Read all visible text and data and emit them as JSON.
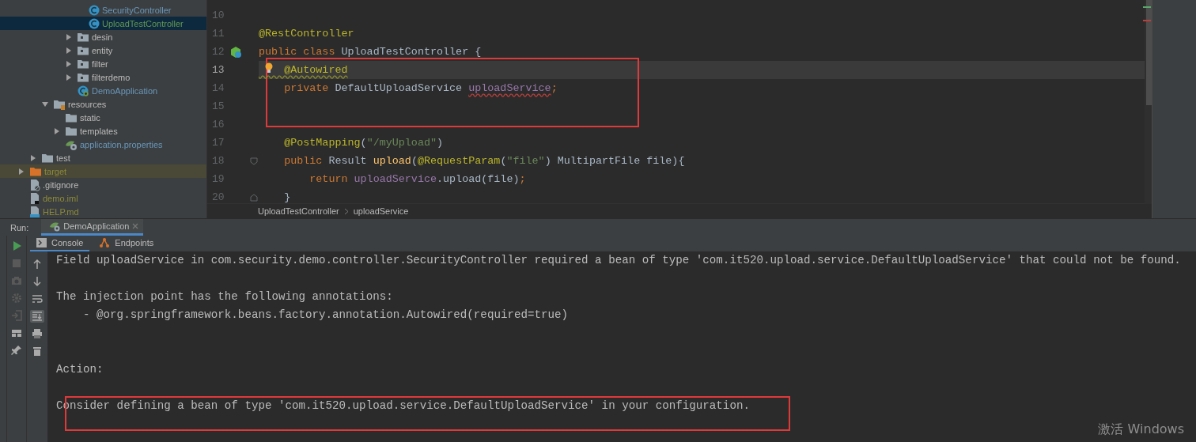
{
  "project_tree": [
    {
      "children": [
        {
          "children": [
            {
              "children": [
                {
                  "children": [
                    {
                      "children": [
                        {
                          "label": "SecurityController",
                          "kind": "class",
                          "color": "#6897bb",
                          "selected": false
                        },
                        {
                          "label": "UploadTestController",
                          "kind": "class",
                          "color": "#629755",
                          "selected": true
                        }
                      ]
                    },
                    {
                      "label": "desin",
                      "kind": "package",
                      "color": "#bbbbbb",
                      "expanded": false,
                      "selected": false
                    },
                    {
                      "label": "entity",
                      "kind": "package",
                      "color": "#bbbbbb",
                      "expanded": false,
                      "selected": false
                    },
                    {
                      "label": "filter",
                      "kind": "package",
                      "color": "#bbbbbb",
                      "expanded": false,
                      "selected": false
                    },
                    {
                      "label": "filterdemo",
                      "kind": "package",
                      "color": "#bbbbbb",
                      "expanded": false,
                      "selected": false
                    },
                    {
                      "label": "DemoApplication",
                      "kind": "spring-class",
                      "color": "#6897bb",
                      "selected": false
                    }
                  ]
                }
              ]
            },
            {
              "label": "resources",
              "kind": "resources-folder",
              "color": "#bbbbbb",
              "expanded": true,
              "selected": false,
              "children": [
                {
                  "label": "static",
                  "kind": "folder",
                  "color": "#bbbbbb",
                  "selected": false
                },
                {
                  "label": "templates",
                  "kind": "folder",
                  "color": "#bbbbbb",
                  "expanded": false,
                  "selected": false
                },
                {
                  "label": "application.properties",
                  "kind": "properties",
                  "color": "#6897bb",
                  "selected": false
                }
              ]
            }
          ]
        },
        {
          "label": "test",
          "kind": "folder",
          "color": "#bbbbbb",
          "expanded": false,
          "selected": false
        }
      ]
    },
    {
      "label": "target",
      "kind": "excluded-folder",
      "color": "#8c8a3a",
      "expanded": false,
      "selected": false
    },
    {
      "label": ".gitignore",
      "kind": "git-file",
      "color": "#bbbbbb",
      "selected": false
    },
    {
      "label": "demo.iml",
      "kind": "module-file",
      "color": "#8c8a3a",
      "selected": false
    },
    {
      "label": "HELP.md",
      "kind": "md-file",
      "color": "#8c8a3a",
      "selected": false
    }
  ],
  "editor": {
    "lines": [
      {
        "number": "10",
        "current": false
      },
      {
        "number": "11",
        "current": false,
        "tokens": [
          {
            "kind": "annotation",
            "text": "@RestController"
          }
        ]
      },
      {
        "number": "12",
        "current": false,
        "bean_marker": true,
        "tokens": [
          {
            "kind": "keyword",
            "text": "public class "
          },
          {
            "kind": "plain",
            "text": "UploadTestController {"
          }
        ]
      },
      {
        "number": "13",
        "current": true,
        "framed": true,
        "bulb": true,
        "tokens": [
          {
            "kind": "annotation",
            "text": "    @Autowired",
            "warning_underline": true
          }
        ]
      },
      {
        "number": "14",
        "current": false,
        "framed": true,
        "tokens": [
          {
            "kind": "keyword",
            "text": "    private "
          },
          {
            "kind": "plain",
            "text": "DefaultUploadService "
          },
          {
            "kind": "field",
            "text": "uploadService",
            "error_underline": true
          },
          {
            "kind": "keyword",
            "text": ";"
          }
        ]
      },
      {
        "number": "15",
        "current": false,
        "framed": true
      },
      {
        "number": "16",
        "current": false,
        "framed": true
      },
      {
        "number": "17",
        "current": false,
        "tokens": [
          {
            "kind": "annotation",
            "text": "    @PostMapping"
          },
          {
            "kind": "plain",
            "text": "("
          },
          {
            "kind": "string",
            "text": "\"/myUpload\""
          },
          {
            "kind": "plain",
            "text": ")"
          }
        ]
      },
      {
        "number": "18",
        "current": false,
        "fold_start": true,
        "tokens": [
          {
            "kind": "keyword",
            "text": "    public "
          },
          {
            "kind": "plain",
            "text": "Result "
          },
          {
            "kind": "method",
            "text": "upload"
          },
          {
            "kind": "plain",
            "text": "("
          },
          {
            "kind": "annotation",
            "text": "@RequestParam"
          },
          {
            "kind": "plain",
            "text": "("
          },
          {
            "kind": "string",
            "text": "\"file\""
          },
          {
            "kind": "plain",
            "text": ") MultipartFile file){"
          }
        ]
      },
      {
        "number": "19",
        "current": false,
        "tokens": [
          {
            "kind": "keyword",
            "text": "        return "
          },
          {
            "kind": "field",
            "text": "uploadService"
          },
          {
            "kind": "plain",
            "text": ".upload(file)"
          },
          {
            "kind": "keyword",
            "text": ";"
          }
        ]
      },
      {
        "number": "20",
        "current": false,
        "fold_end": true,
        "tokens": [
          {
            "kind": "plain",
            "text": "    }"
          }
        ]
      }
    ],
    "breadcrumbs": [
      "UploadTestController",
      "uploadService"
    ]
  },
  "run_panel": {
    "label": "Run:",
    "tabs": [
      {
        "label": "DemoApplication",
        "selected": true
      }
    ],
    "console_tabs": [
      {
        "label": "Console",
        "kind": "console",
        "selected": true
      },
      {
        "label": "Endpoints",
        "kind": "endpoints",
        "selected": false
      }
    ],
    "scroll_to_end_on": true,
    "console_lines": [
      {
        "kind": "text",
        "text": "Field uploadService in com.security.demo.controller.SecurityController required a bean of type 'com.it520.upload.service.DefaultUploadService' that could not be found."
      },
      {
        "kind": "blank"
      },
      {
        "kind": "text",
        "text": "The injection point has the following annotations:"
      },
      {
        "kind": "text",
        "text": "    - @org.springframework.beans.factory.annotation.Autowired(required=true)"
      },
      {
        "kind": "blank"
      },
      {
        "kind": "blank"
      },
      {
        "kind": "text",
        "text": "Action:"
      },
      {
        "kind": "blank"
      },
      {
        "kind": "text",
        "text": "Consider defining a bean of type 'com.it520.upload.service.DefaultUploadService' in your configuration.",
        "framed": true
      }
    ]
  },
  "os_notice": "激活 Windows"
}
